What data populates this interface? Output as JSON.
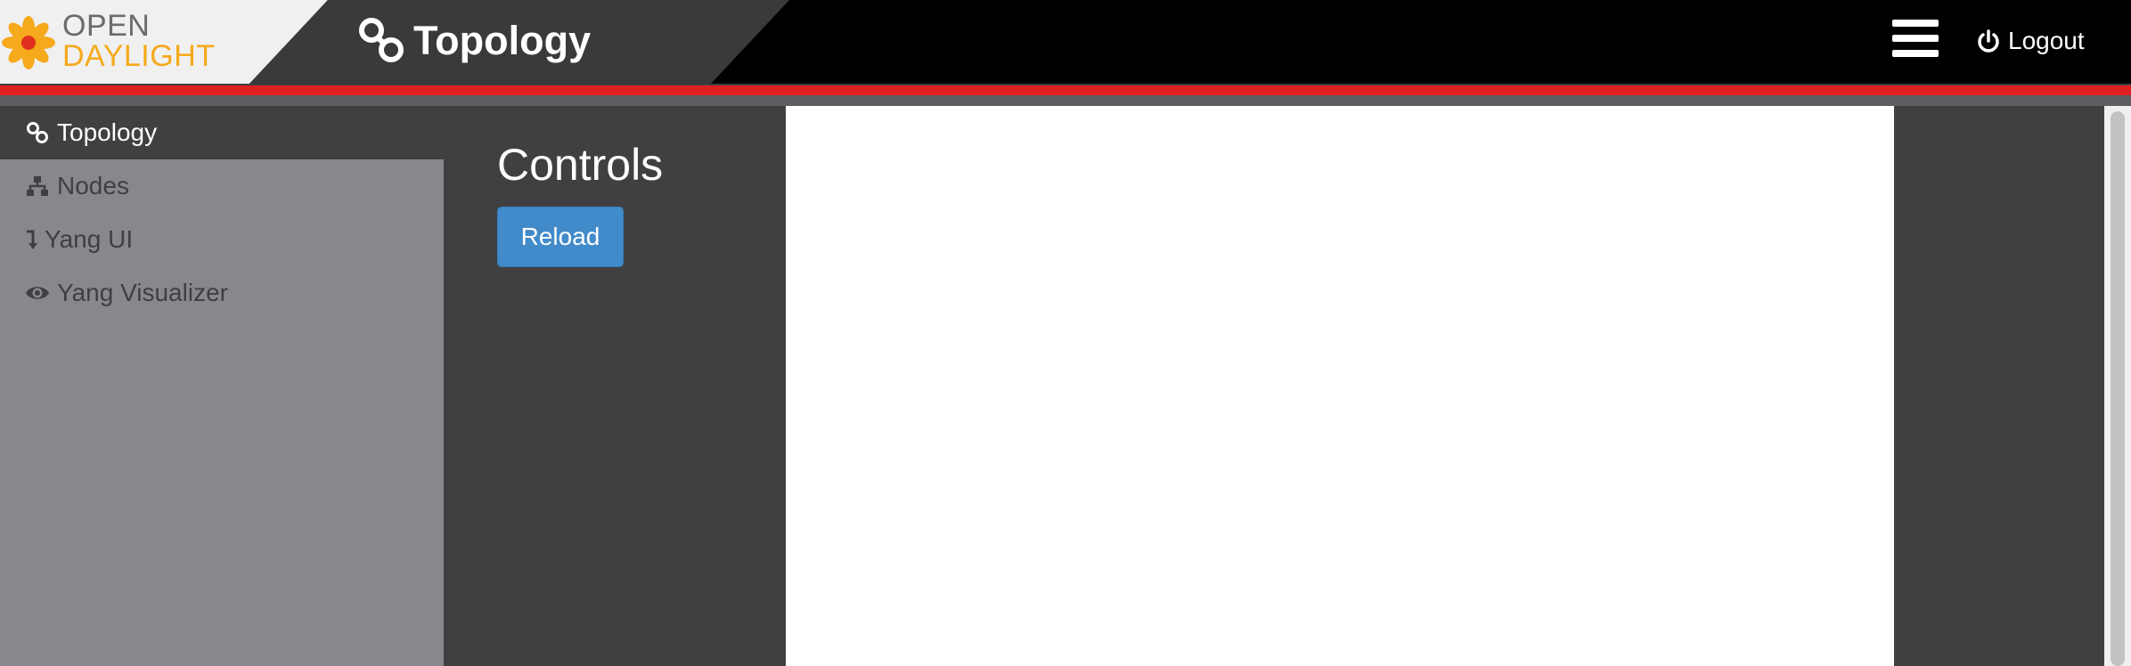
{
  "header": {
    "logo": {
      "line1": "OPEN",
      "line2": "DAYLIGHT",
      "icon": "opendaylight-flower-icon"
    },
    "title": "Topology",
    "title_icon": "topology-link-icon",
    "menu_icon": "hamburger-menu-icon",
    "logout_label": "Logout",
    "logout_icon": "power-icon"
  },
  "sidebar": {
    "items": [
      {
        "label": "Topology",
        "icon": "topology-link-icon",
        "active": true
      },
      {
        "label": "Nodes",
        "icon": "sitemap-icon",
        "active": false
      },
      {
        "label": "Yang UI",
        "icon": "level-down-icon",
        "active": false
      },
      {
        "label": "Yang Visualizer",
        "icon": "eye-icon",
        "active": false
      }
    ]
  },
  "controls": {
    "title": "Controls",
    "reload_label": "Reload"
  },
  "colors": {
    "topbar": "#000000",
    "accent_red": "#e02020",
    "logo_orange": "#f5a91b",
    "button_blue": "#428bca",
    "sidebar_bg": "#87888b",
    "panel_bg": "#404042"
  }
}
